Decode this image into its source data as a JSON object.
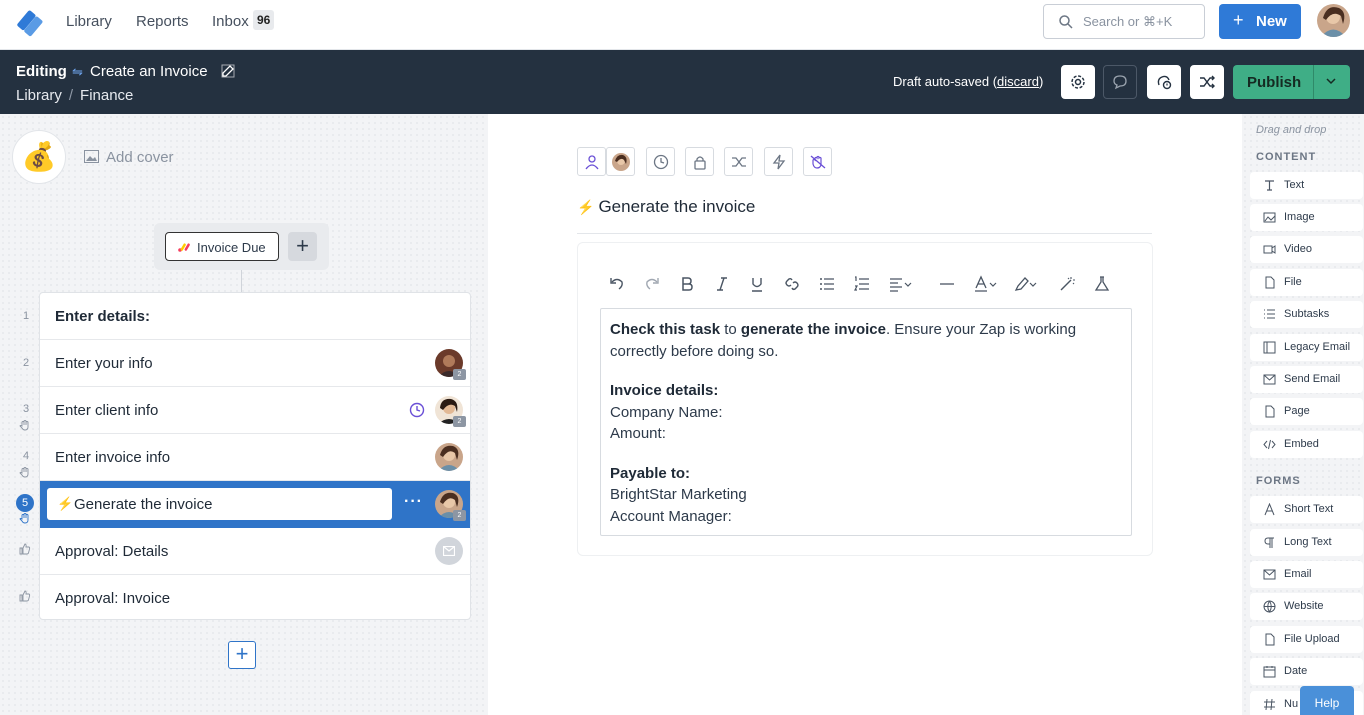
{
  "topnav": {
    "links": [
      "Library",
      "Reports",
      "Inbox"
    ],
    "inbox_count": "96",
    "search_placeholder": "Search or ⌘+K",
    "new_label": "New"
  },
  "editbar": {
    "mode": "Editing",
    "workflow_title": "Create an Invoice",
    "breadcrumb": [
      "Library",
      "Finance"
    ],
    "draft_text": "Draft auto-saved (",
    "discard": "discard",
    "draft_close": ")",
    "publish_label": "Publish"
  },
  "left": {
    "add_cover": "Add cover",
    "emoji": "💰",
    "trigger_label": "Invoice Due",
    "tasks": [
      {
        "num": "1",
        "label": "Enter details:"
      },
      {
        "num": "2",
        "label": "Enter your info"
      },
      {
        "num": "3",
        "label": "Enter client info"
      },
      {
        "num": "4",
        "label": "Enter invoice info"
      },
      {
        "num": "5",
        "label": "Generate the invoice"
      },
      {
        "num": "",
        "label": "Approval: Details"
      },
      {
        "num": "",
        "label": "Approval: Invoice"
      }
    ],
    "avatar_badge": "2"
  },
  "center": {
    "task_title": "Generate the invoice",
    "content": {
      "p1_b1": "Check this task",
      "p1_t1": " to ",
      "p1_b2": "generate the invoice",
      "p1_t2": ". Ensure your Zap is working correctly before doing so.",
      "invoice_heading": "Invoice details:",
      "company": "Company Name:",
      "amount": "Amount:",
      "payable_heading": "Payable to:",
      "payee": "BrightStar Marketing",
      "manager": "Account Manager:"
    }
  },
  "right": {
    "drag_drop": "Drag and drop",
    "content_heading": "CONTENT",
    "content_items": [
      "Text",
      "Image",
      "Video",
      "File",
      "Subtasks",
      "Legacy Email",
      "Send Email",
      "Page",
      "Embed"
    ],
    "forms_heading": "FORMS",
    "form_items": [
      "Short Text",
      "Long Text",
      "Email",
      "Website",
      "File Upload",
      "Date",
      "Nu"
    ],
    "help": "Help"
  },
  "colors": {
    "accent": "#2f7ad7",
    "topbar_dark": "#243140",
    "publish": "#3fae86",
    "active_task": "#2f74c8"
  }
}
